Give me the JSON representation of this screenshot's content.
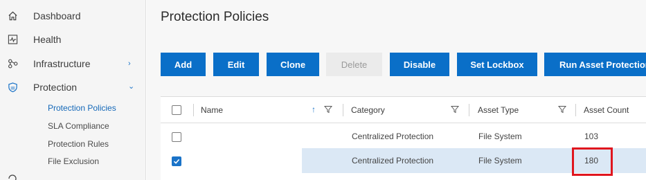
{
  "sidebar": {
    "items": [
      {
        "label": "Dashboard",
        "icon": "home-icon"
      },
      {
        "label": "Health",
        "icon": "health-pulse-icon"
      },
      {
        "label": "Infrastructure",
        "icon": "infrastructure-nodes-icon",
        "chevron": "›"
      },
      {
        "label": "Protection",
        "icon": "shield-icon",
        "chevron": "⌄"
      }
    ],
    "protection_sub": [
      {
        "label": "Protection Policies",
        "active": true
      },
      {
        "label": "SLA Compliance"
      },
      {
        "label": "Protection Rules"
      },
      {
        "label": "File Exclusion"
      }
    ]
  },
  "page": {
    "title": "Protection Policies"
  },
  "toolbar": {
    "add": "Add",
    "edit": "Edit",
    "clone": "Clone",
    "delete": "Delete",
    "disable": "Disable",
    "set_lockbox": "Set Lockbox",
    "run_asset_protection": "Run Asset Protection"
  },
  "table": {
    "columns": {
      "name": "Name",
      "category": "Category",
      "asset_type": "Asset Type",
      "asset_count": "Asset Count"
    },
    "sort": {
      "column": "name",
      "direction": "ascending"
    },
    "rows": [
      {
        "name": "",
        "category": "Centralized Protection",
        "asset_type": "File System",
        "asset_count": "103",
        "selected": false
      },
      {
        "name": "",
        "category": "Centralized Protection",
        "asset_type": "File System",
        "asset_count": "180",
        "selected": true
      }
    ]
  },
  "colors": {
    "primary_button": "#0a6fc8",
    "selected_row": "#dbe8f5",
    "annotation_red": "#e0161e",
    "active_nav_text": "#1468b8"
  }
}
